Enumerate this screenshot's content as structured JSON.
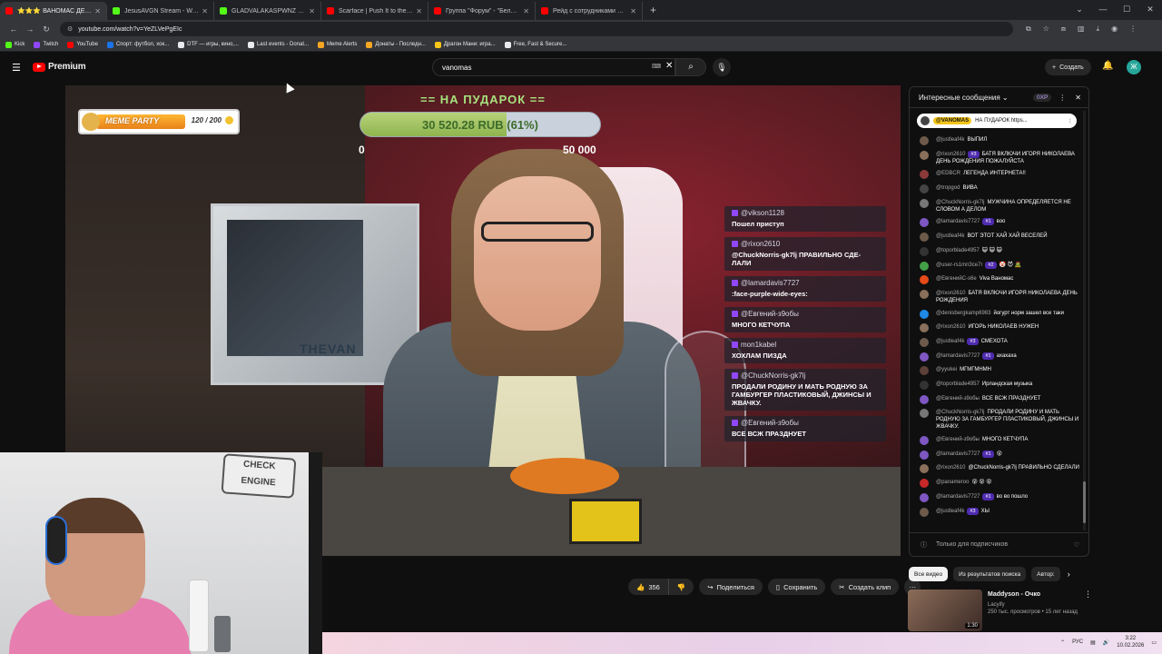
{
  "browser": {
    "tabs": [
      {
        "label": "⭐⭐⭐ ВАНОМАС ДЕНЬ РО",
        "color": "#ff0000",
        "active": true
      },
      {
        "label": "JesusAVGN Stream - Watch Liv",
        "color": "#53fc18"
      },
      {
        "label": "GLADVALAKASPWNZ Stream -",
        "color": "#53fc18"
      },
      {
        "label": "Scarface | Push It to the Limit",
        "color": "#ff0000"
      },
      {
        "label": "Группа \"Форум\" - \"Белая ноч",
        "color": "#ff0000"
      },
      {
        "label": "Рейд с сотрудниками ППСП У",
        "color": "#ff0000"
      }
    ],
    "url": "youtube.com/watch?v=YeZLVePgEIc",
    "bookmarks": [
      {
        "label": "Kick",
        "color": "#53fc18"
      },
      {
        "label": "Twitch",
        "color": "#9147ff"
      },
      {
        "label": "YouTube",
        "color": "#ff0000"
      },
      {
        "label": "Спорт: футбол, хок...",
        "color": "#1a73e8"
      },
      {
        "label": "DTF — игры, кино,...",
        "color": "#e8eaed"
      },
      {
        "label": "Last events - Donat...",
        "color": "#e8eaed"
      },
      {
        "label": "Meme Alerts",
        "color": "#f5a623"
      },
      {
        "label": "Донаты - Последн...",
        "color": "#f5a623"
      },
      {
        "label": "Драгон Мани: игра...",
        "color": "#f5c518"
      },
      {
        "label": "Free, Fast & Secure...",
        "color": "#e8eaed"
      }
    ]
  },
  "youtube": {
    "brand": "Premium",
    "search_value": "vanomas",
    "create_label": "Создать",
    "avatar_letter": "Ж"
  },
  "overlay": {
    "goal_title": "== НА ПУДАРОК ==",
    "goal_text": "30 520.28 RUB (61%)",
    "goal_progress": 0.61,
    "goal_min": "0",
    "goal_max": "50 000",
    "meme_label": "MEME PARTY",
    "meme_count": "120 / 200",
    "pc_label": "THEVAN",
    "messages": [
      {
        "name": "@vikson1128",
        "text": "Пошел приступ"
      },
      {
        "name": "@rixon2610",
        "text": "@ChuckNorris-gk7lj ПРАВИЛЬНО СДЕ-ЛАЛИ"
      },
      {
        "name": "@lamardavis7727",
        "text": ":face-purple-wide-eyes:"
      },
      {
        "name": "@Евгений-з9обы",
        "text": "МНОГО КЕТЧУПА"
      },
      {
        "name": "mon1kabel",
        "text": "ХОХЛАМ ПИЗДА"
      },
      {
        "name": "@ChuckNorris-gk7lj",
        "text": "ПРОДАЛИ РОДИНУ И МАТЬ РОДНУЮ ЗА ГАМБУРГЕР ПЛАСТИКОВЫЙ, ДЖИНСЫ И ЖВАЧКУ."
      },
      {
        "name": "@Евгений-з9обы",
        "text": "ВСЕ ВСЖ ПРАЗДНУЕТ"
      }
    ]
  },
  "webcam": {
    "sign": "CHECK ENGINE"
  },
  "actions": {
    "like_count": "356",
    "share": "Поделиться",
    "save": "Сохранить",
    "clip": "Создать клип"
  },
  "chat": {
    "title": "Интересные сообщения",
    "xp": "0XP",
    "pinned_name": "@VANOMAS",
    "pinned_text": "НА ПУДАРОК https...",
    "messages": [
      {
        "name": "@justleaf4k",
        "badge": "",
        "text": "ВЫПИЛ",
        "color": "#6d5a4a"
      },
      {
        "name": "@rixon2610",
        "badge": "#3",
        "text": "БАТЯ ВКЛЮЧИ ИГОРЯ НИКОЛАЕВА ДЕНЬ РОЖДЕНИЯ ПОЖАЛУЙСТА",
        "color": "#8a6f5a"
      },
      {
        "name": "@EDBCR",
        "badge": "",
        "text": "ЛЕГЕНДА ИНТЕРНЕТА!!",
        "color": "#8b3a3a"
      },
      {
        "name": "@tropgod",
        "badge": "",
        "text": "ВИВА",
        "color": "#444"
      },
      {
        "name": "@ChuckNorris-gk7lj",
        "badge": "",
        "text": "МУЖЧИНА ОПРЕДЕЛЯЕТСЯ НЕ СЛОВОМ А ДЕЛОМ",
        "color": "#777"
      },
      {
        "name": "@lamardavis7727",
        "badge": "#1",
        "text": "воо",
        "color": "#7e57c2"
      },
      {
        "name": "@justleaf4k",
        "badge": "",
        "text": "ВОТ ЭТОТ ХАЙ ХАЙ ВЕСЕЛЕЙ",
        "color": "#6d5a4a"
      },
      {
        "name": "@toporblade4957",
        "badge": "",
        "text": "😺 😺 😺",
        "color": "#333"
      },
      {
        "name": "@user-rs1mn3ce7r",
        "badge": "#2",
        "text": "🤡 😈 🧟",
        "color": "#43a047"
      },
      {
        "name": "@ЕвгенийС-s6e",
        "badge": "",
        "text": "Viva Ваномас",
        "color": "#e64a19"
      },
      {
        "name": "@rixon2610",
        "badge": "",
        "text": "БАТЯ ВКЛЮЧИ ИГОРЯ НИКОЛАЕВА ДЕНЬ РОЖДЕНИЯ",
        "color": "#8a6f5a"
      },
      {
        "name": "@denisbergkamp6983",
        "badge": "",
        "text": "йогурт норм зашел все таки",
        "color": "#1e88e5"
      },
      {
        "name": "@rixon2610",
        "badge": "",
        "text": "ИГОРЬ НИКОЛАЕВ НУЖЕН",
        "color": "#8a6f5a"
      },
      {
        "name": "@justleaf4k",
        "badge": "#3",
        "text": "СМЕХОТА",
        "color": "#6d5a4a"
      },
      {
        "name": "@lamardavis7727",
        "badge": "#1",
        "text": "ахахаха",
        "color": "#7e57c2"
      },
      {
        "name": "@yyukei",
        "badge": "",
        "text": "МГМГМНМН",
        "color": "#5d4037"
      },
      {
        "name": "@toporblade4957",
        "badge": "",
        "text": "Ирландская музыка",
        "color": "#333"
      },
      {
        "name": "@Евгений-з9обы",
        "badge": "",
        "text": "ВСЕ ВСЖ ПРАЗДНУЕТ",
        "color": "#7e57c2"
      },
      {
        "name": "@ChuckNorris-gk7lj",
        "badge": "",
        "text": "ПРОДАЛИ РОДИНУ И МАТЬ РОДНУЮ ЗА ГАМБУРГЕР ПЛАСТИКОВЫЙ, ДЖИНСЫ И ЖВАЧКУ.",
        "color": "#777"
      },
      {
        "name": "@Евгений-з9обы",
        "badge": "",
        "text": "МНОГО КЕТЧУПА",
        "color": "#7e57c2"
      },
      {
        "name": "@lamardavis7727",
        "badge": "#1",
        "text": "😵",
        "color": "#7e57c2"
      },
      {
        "name": "@rixon2610",
        "badge": "",
        "text": "@ChuckNorris-gk7lj ПРАВИЛЬНО СДЕЛАЛИ",
        "color": "#8a6f5a"
      },
      {
        "name": "@panameroo",
        "badge": "",
        "text": "😵 😵 😵",
        "color": "#c62828"
      },
      {
        "name": "@lamardavis7727",
        "badge": "#1",
        "text": "во во пошло",
        "color": "#7e57c2"
      },
      {
        "name": "@justleaf4k",
        "badge": "#3",
        "text": "ХЫ",
        "color": "#6d5a4a"
      }
    ],
    "footer": "Только для подписчиков"
  },
  "related": {
    "chips": [
      "Все видео",
      "Из результатов поиска",
      "Автор:"
    ],
    "video": {
      "title": "Maddyson - Очко",
      "channel": "Lacyify",
      "meta": "250 тыс. просмотров • 15 лет назад",
      "duration": "1:30"
    }
  },
  "taskbar": {
    "lang": "РУС",
    "time": "3:22",
    "date": "10.02.2026"
  }
}
